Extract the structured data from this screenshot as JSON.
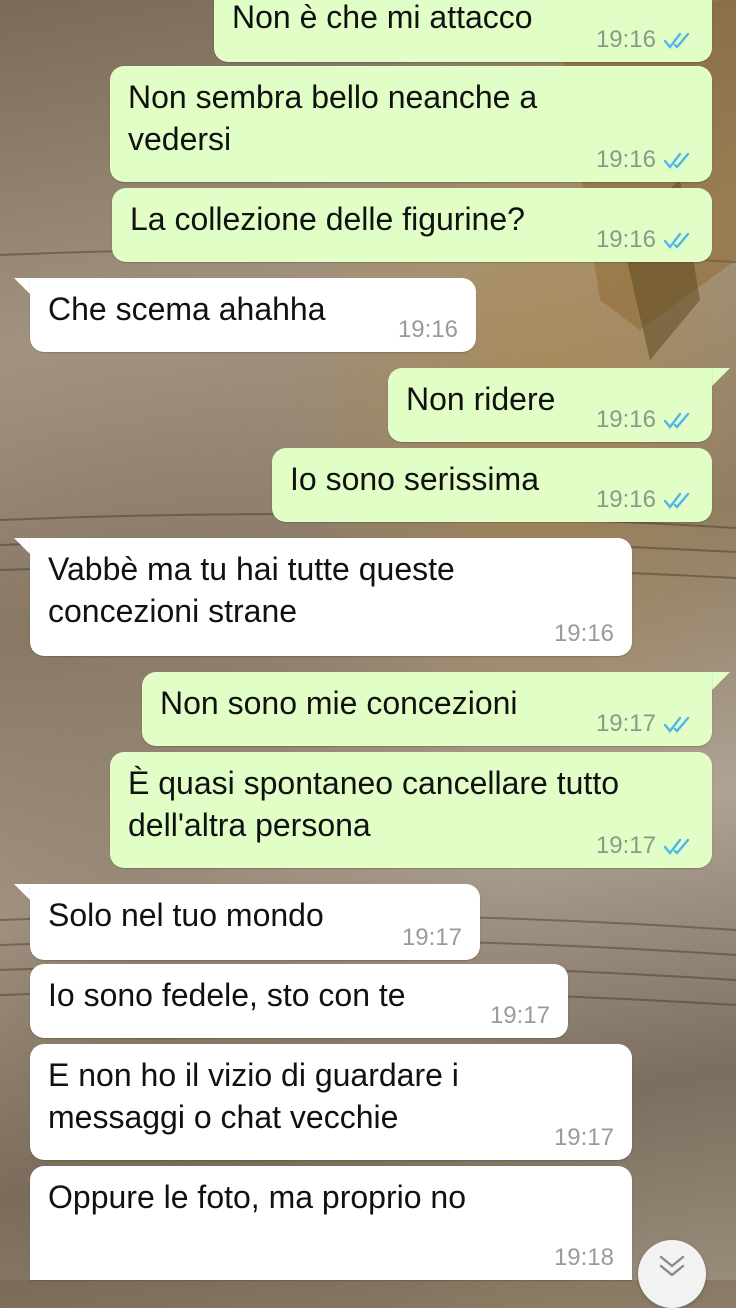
{
  "messages": [
    {
      "id": 1,
      "direction": "out",
      "text": "Non è che mi attacco",
      "time": "19:16",
      "read": true
    },
    {
      "id": 2,
      "direction": "out",
      "text": "Non sembra bello neanche a\nvedersi",
      "time": "19:16",
      "read": true
    },
    {
      "id": 3,
      "direction": "out",
      "text": "La collezione delle figurine?",
      "time": "19:16",
      "read": true
    },
    {
      "id": 4,
      "direction": "in",
      "text": "Che scema ahahha",
      "time": "19:16"
    },
    {
      "id": 5,
      "direction": "out",
      "text": "Non ridere",
      "time": "19:16",
      "read": true
    },
    {
      "id": 6,
      "direction": "out",
      "text": "Io sono serissima",
      "time": "19:16",
      "read": true
    },
    {
      "id": 7,
      "direction": "in",
      "text": "Vabbè ma tu hai tutte queste\nconcezioni strane",
      "time": "19:16"
    },
    {
      "id": 8,
      "direction": "out",
      "text": "Non sono mie concezioni",
      "time": "19:17",
      "read": true
    },
    {
      "id": 9,
      "direction": "out",
      "text": "È quasi spontaneo cancellare tutto\ndell'altra persona",
      "time": "19:17",
      "read": true
    },
    {
      "id": 10,
      "direction": "in",
      "text": "Solo nel tuo mondo",
      "time": "19:17"
    },
    {
      "id": 11,
      "direction": "in",
      "text": "Io sono fedele, sto con te",
      "time": "19:17"
    },
    {
      "id": 12,
      "direction": "in",
      "text": "E non ho il vizio di guardare i\nmessaggi o chat vecchie",
      "time": "19:17"
    },
    {
      "id": 13,
      "direction": "in",
      "text": "Oppure le foto, ma proprio no",
      "time": "19:18"
    }
  ],
  "colors": {
    "outgoing_bubble": "#e1fec6",
    "incoming_bubble": "#ffffff",
    "read_ticks": "#4fb6ec"
  },
  "icons": {
    "read_receipt": "double-check-icon",
    "scroll_down": "chevron-double-down-icon"
  }
}
